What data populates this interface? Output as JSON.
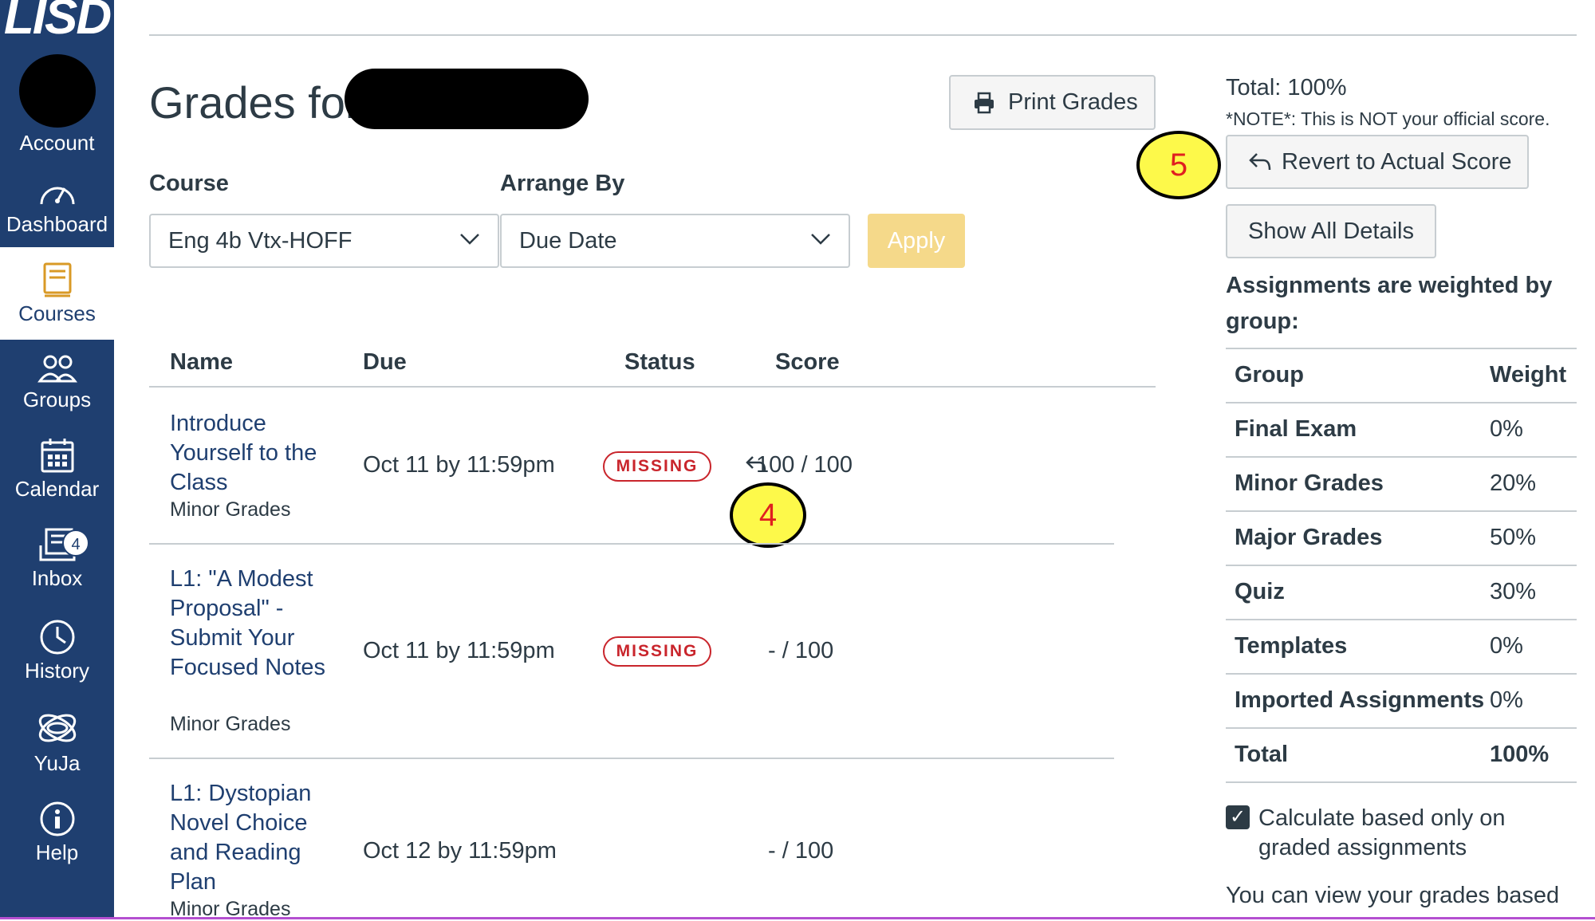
{
  "sidebar": {
    "logo": "LISD",
    "items": [
      {
        "label": "Account",
        "icon": "avatar"
      },
      {
        "label": "Dashboard",
        "icon": "dashboard-icon"
      },
      {
        "label": "Courses",
        "icon": "courses-icon",
        "active": true
      },
      {
        "label": "Groups",
        "icon": "groups-icon"
      },
      {
        "label": "Calendar",
        "icon": "calendar-icon"
      },
      {
        "label": "Inbox",
        "icon": "inbox-icon",
        "badge": "4"
      },
      {
        "label": "History",
        "icon": "clock-icon"
      },
      {
        "label": "YuJa",
        "icon": "yuja-icon"
      },
      {
        "label": "Help",
        "icon": "help-icon"
      }
    ]
  },
  "header": {
    "title": "Grades for",
    "print_label": "Print Grades"
  },
  "filters": {
    "course_label": "Course",
    "course_value": "Eng 4b Vtx-HOFF",
    "arrange_label": "Arrange By",
    "arrange_value": "Due Date",
    "apply_label": "Apply"
  },
  "table": {
    "headers": [
      "Name",
      "Due",
      "Status",
      "Score"
    ],
    "rows": [
      {
        "name": "Introduce Yourself to the Class",
        "group": "Minor Grades",
        "due": "Oct 11 by 11:59pm",
        "status": "MISSING",
        "score": "100 / 100"
      },
      {
        "name": "L1: \"A Modest Proposal\" - Submit Your Focused Notes",
        "group": "Minor Grades",
        "due": "Oct 11 by 11:59pm",
        "status": "MISSING",
        "score": "- / 100"
      },
      {
        "name": "L1: Dystopian Novel Choice and Reading Plan",
        "group": "Minor Grades",
        "due": "Oct 12 by 11:59pm",
        "status": "",
        "score": "- / 100"
      }
    ]
  },
  "callouts": {
    "score": "4",
    "revert": "5"
  },
  "summary": {
    "total": "Total: 100%",
    "note": "*NOTE*: This is NOT your official score.",
    "revert_label": "Revert to Actual Score",
    "details_label": "Show All Details",
    "weighted_text": "Assignments are weighted by group:",
    "weights_header": {
      "group": "Group",
      "weight": "Weight"
    },
    "weights": [
      {
        "group": "Final Exam",
        "weight": "0%"
      },
      {
        "group": "Minor Grades",
        "weight": "20%"
      },
      {
        "group": "Major Grades",
        "weight": "50%"
      },
      {
        "group": "Quiz",
        "weight": "30%"
      },
      {
        "group": "Templates",
        "weight": "0%"
      },
      {
        "group": "Imported Assignments",
        "weight": "0%"
      },
      {
        "group": "Total",
        "weight": "100%"
      }
    ],
    "calc_label": "Calculate based only on graded assignments",
    "calc_checked": true,
    "view_text": "You can view your grades based"
  },
  "colors": {
    "sidebar": "#1f3f70",
    "link": "#1f3f70",
    "missing": "#c9252c",
    "apply": "#f5d98a",
    "callout": "#fdf94a"
  }
}
